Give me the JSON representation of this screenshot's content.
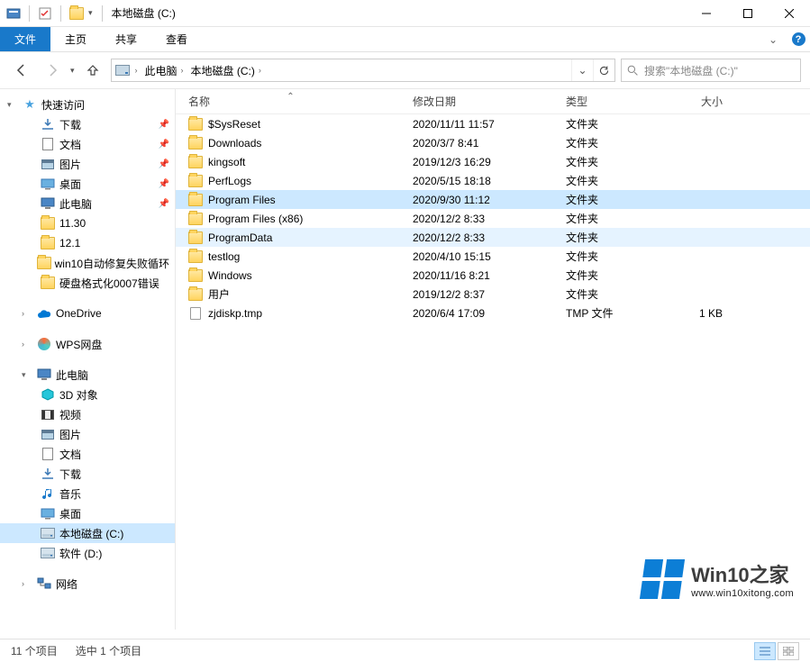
{
  "title": "本地磁盘 (C:)",
  "ribbon": {
    "file": "文件",
    "home": "主页",
    "share": "共享",
    "view": "查看"
  },
  "breadcrumbs": {
    "pc": "此电脑",
    "drive": "本地磁盘 (C:)"
  },
  "search": {
    "placeholder": "搜索\"本地磁盘 (C:)\""
  },
  "columns": {
    "name": "名称",
    "date": "修改日期",
    "type": "类型",
    "size": "大小"
  },
  "sidebar": {
    "quick": "快速访问",
    "quick_items": [
      {
        "label": "下载",
        "icon": "dl",
        "pin": true
      },
      {
        "label": "文档",
        "icon": "doc",
        "pin": true
      },
      {
        "label": "图片",
        "icon": "img",
        "pin": true
      },
      {
        "label": "桌面",
        "icon": "desktop",
        "pin": true
      },
      {
        "label": "此电脑",
        "icon": "pc",
        "pin": true
      },
      {
        "label": "11.30",
        "icon": "folder",
        "pin": false
      },
      {
        "label": "12.1",
        "icon": "folder",
        "pin": false
      },
      {
        "label": "win10自动修复失败循环",
        "icon": "folder",
        "pin": false
      },
      {
        "label": "硬盘格式化0007错误",
        "icon": "folder",
        "pin": false
      }
    ],
    "onedrive": "OneDrive",
    "wps": "WPS网盘",
    "thispc": "此电脑",
    "pc_items": [
      {
        "label": "3D 对象",
        "icon": "3d"
      },
      {
        "label": "视频",
        "icon": "video"
      },
      {
        "label": "图片",
        "icon": "img"
      },
      {
        "label": "文档",
        "icon": "doc"
      },
      {
        "label": "下载",
        "icon": "dl"
      },
      {
        "label": "音乐",
        "icon": "music"
      },
      {
        "label": "桌面",
        "icon": "desktop"
      },
      {
        "label": "本地磁盘 (C:)",
        "icon": "drive",
        "selected": true
      },
      {
        "label": "软件 (D:)",
        "icon": "drive"
      }
    ],
    "network": "网络"
  },
  "files": [
    {
      "name": "$SysReset",
      "date": "2020/11/11 11:57",
      "type": "文件夹",
      "size": "",
      "icon": "folder"
    },
    {
      "name": "Downloads",
      "date": "2020/3/7 8:41",
      "type": "文件夹",
      "size": "",
      "icon": "folder"
    },
    {
      "name": "kingsoft",
      "date": "2019/12/3 16:29",
      "type": "文件夹",
      "size": "",
      "icon": "folder"
    },
    {
      "name": "PerfLogs",
      "date": "2020/5/15 18:18",
      "type": "文件夹",
      "size": "",
      "icon": "folder"
    },
    {
      "name": "Program Files",
      "date": "2020/9/30 11:12",
      "type": "文件夹",
      "size": "",
      "icon": "folder",
      "selected": true
    },
    {
      "name": "Program Files (x86)",
      "date": "2020/12/2 8:33",
      "type": "文件夹",
      "size": "",
      "icon": "folder"
    },
    {
      "name": "ProgramData",
      "date": "2020/12/2 8:33",
      "type": "文件夹",
      "size": "",
      "icon": "folder",
      "hover": true
    },
    {
      "name": "testlog",
      "date": "2020/4/10 15:15",
      "type": "文件夹",
      "size": "",
      "icon": "folder"
    },
    {
      "name": "Windows",
      "date": "2020/11/16 8:21",
      "type": "文件夹",
      "size": "",
      "icon": "folder"
    },
    {
      "name": "用户",
      "date": "2019/12/2 8:37",
      "type": "文件夹",
      "size": "",
      "icon": "folder"
    },
    {
      "name": "zjdiskp.tmp",
      "date": "2020/6/4 17:09",
      "type": "TMP 文件",
      "size": "1 KB",
      "icon": "file"
    }
  ],
  "status": {
    "items": "11 个项目",
    "selected": "选中 1 个项目"
  },
  "watermark": {
    "title": "Win10之家",
    "url": "www.win10xitong.com"
  }
}
